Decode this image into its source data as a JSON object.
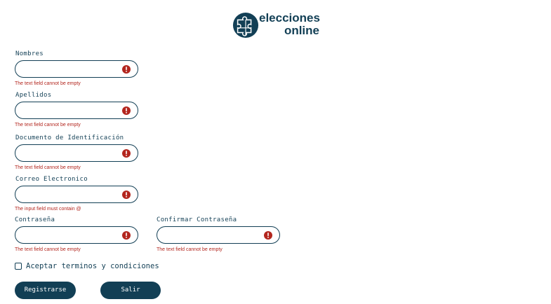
{
  "brand": {
    "line1": "elecciones",
    "line2": "online",
    "color": "#123f55"
  },
  "form": {
    "nombres": {
      "label": "Nombres",
      "value": "",
      "error": "The text field cannot be empty"
    },
    "apellidos": {
      "label": "Apellidos",
      "value": "",
      "error": "The text field cannot be empty"
    },
    "documento": {
      "label": "Documento de Identificación",
      "value": "",
      "error": "The text field cannot be empty"
    },
    "correo": {
      "label": "Correo Electronico",
      "value": "",
      "error": "The input field must contain @"
    },
    "contrasena": {
      "label": "Contraseña",
      "value": "",
      "error": "The text field cannot be empty"
    },
    "confirmar": {
      "label": "Confirmar Contraseña",
      "value": "",
      "error": "The text field cannot be empty"
    },
    "terms": {
      "label": "Aceptar terminos y condiciones",
      "checked": false
    },
    "register_label": "Registrarse",
    "exit_label": "Salir"
  },
  "colors": {
    "primary": "#123f55",
    "error": "#b3261e"
  },
  "icons": {
    "error": "error-circle-icon",
    "logo": "puzzle-icon"
  }
}
